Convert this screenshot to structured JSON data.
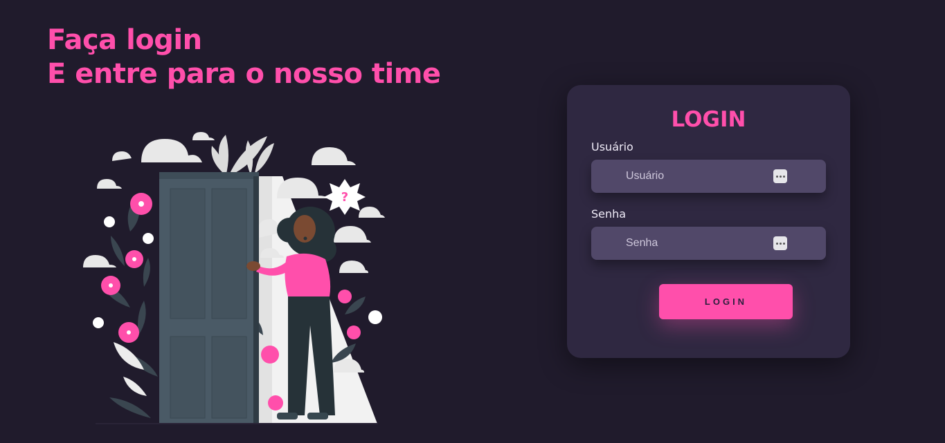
{
  "headline": {
    "line1": "Faça login",
    "line2": "E entre para o nosso time"
  },
  "illustration": {
    "description_icon": "woman-opening-door-illustration",
    "question_mark": "?"
  },
  "card": {
    "title": "LOGIN",
    "username": {
      "label": "Usuário",
      "placeholder": "Usuário"
    },
    "password": {
      "label": "Senha",
      "placeholder": "Senha"
    },
    "button_label": "LOGIN"
  },
  "colors": {
    "background": "#201b2c",
    "card": "#2f2841",
    "input": "#514869",
    "accent": "#ff4fab"
  }
}
